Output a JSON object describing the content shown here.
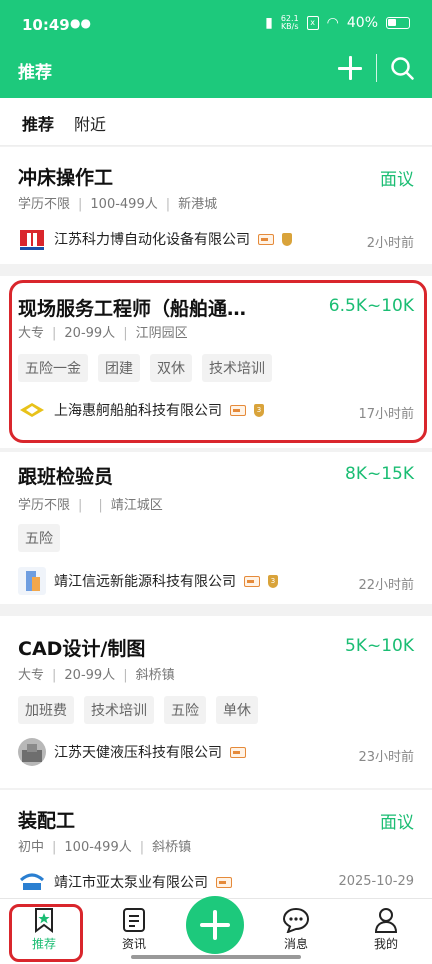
{
  "status": {
    "time": "10:49",
    "net_speed_value": "62.1",
    "net_speed_unit": "KB/s",
    "battery": "40%",
    "sim_x": "x"
  },
  "appbar": {
    "title": "推荐"
  },
  "tabs": [
    {
      "label": "推荐"
    },
    {
      "label": "附近"
    }
  ],
  "jobs": [
    {
      "title": "冲床操作工",
      "salary": "面议",
      "meta": [
        "学历不限",
        "100-499人",
        "新港城"
      ],
      "tags": [],
      "company": "江苏科力博自动化设备有限公司",
      "time": "2小时前"
    },
    {
      "title": "现场服务工程师（船舶通…",
      "salary": "6.5K~10K",
      "meta": [
        "大专",
        "20-99人",
        "江阴园区"
      ],
      "tags": [
        "五险一金",
        "团建",
        "双休",
        "技术培训"
      ],
      "company": "上海惠舸船舶科技有限公司",
      "time": "17小时前"
    },
    {
      "title": "跟班检验员",
      "salary": "8K~15K",
      "meta": [
        "学历不限",
        "",
        "靖江城区"
      ],
      "tags": [
        "五险"
      ],
      "company": "靖江信远新能源科技有限公司",
      "time": "22小时前"
    },
    {
      "title": "CAD设计/制图",
      "salary": "5K~10K",
      "meta": [
        "大专",
        "20-99人",
        "斜桥镇"
      ],
      "tags": [
        "加班费",
        "技术培训",
        "五险",
        "单休"
      ],
      "company": "江苏天健液压科技有限公司",
      "time": "23小时前"
    },
    {
      "title": "装配工",
      "salary": "面议",
      "meta": [
        "初中",
        "100-499人",
        "斜桥镇"
      ],
      "tags": [],
      "company": "靖江市亚太泵业有限公司",
      "time": "2025-10-29"
    }
  ],
  "medal_text": "3",
  "nav": [
    {
      "label": "推荐"
    },
    {
      "label": "资讯"
    },
    {
      "label": "消息"
    },
    {
      "label": "我的"
    }
  ],
  "colors": {
    "brand_green": "#1dc97c",
    "salary_green": "#1bbd73",
    "highlight_red": "#d9262c"
  }
}
